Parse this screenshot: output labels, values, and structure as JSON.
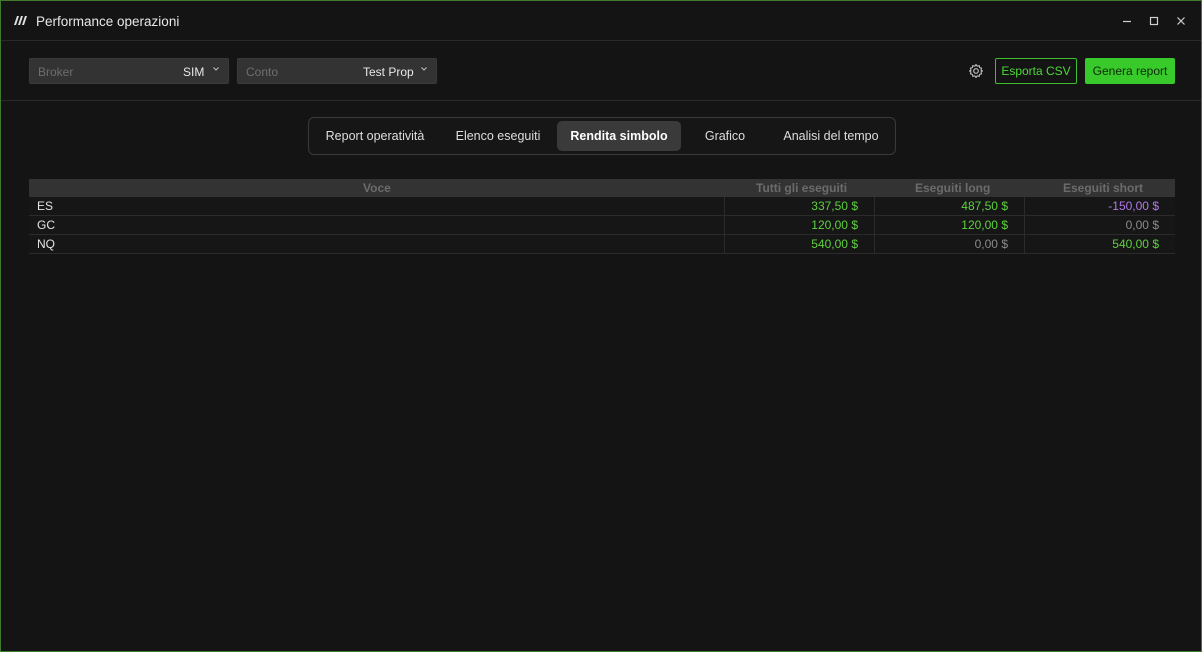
{
  "window": {
    "title": "Performance operazioni"
  },
  "toolbar": {
    "broker": {
      "placeholder": "Broker",
      "value": "SIM"
    },
    "conto": {
      "placeholder": "Conto",
      "value": "Test Prop"
    },
    "export_label": "Esporta CSV",
    "report_label": "Genera report"
  },
  "tabs": [
    {
      "label": "Report operatività",
      "active": false
    },
    {
      "label": "Elenco eseguiti",
      "active": false
    },
    {
      "label": "Rendita simbolo",
      "active": true
    },
    {
      "label": "Grafico",
      "active": false
    },
    {
      "label": "Analisi del tempo",
      "active": false
    }
  ],
  "table": {
    "headers": [
      "Voce",
      "Tutti gli eseguiti",
      "Eseguiti long",
      "Eseguiti short"
    ],
    "rows": [
      {
        "symbol": "ES",
        "all": "337,50 $",
        "long": "487,50 $",
        "short": "-150,00 $"
      },
      {
        "symbol": "GC",
        "all": "120,00 $",
        "long": "120,00 $",
        "short": "0,00 $"
      },
      {
        "symbol": "NQ",
        "all": "540,00 $",
        "long": "0,00 $",
        "short": "540,00 $"
      }
    ]
  },
  "colors": {
    "accent": "#38c92a",
    "positive": "#5fd03f",
    "negative": "#b07ae8",
    "zero": "#8a8a8a",
    "frame": "#3f7a2e"
  }
}
